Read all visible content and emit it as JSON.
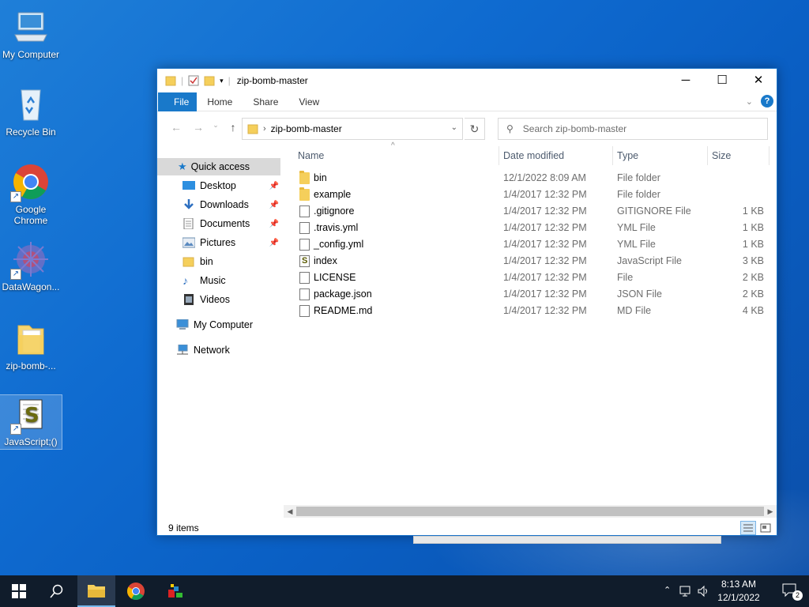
{
  "desktop": {
    "icons": [
      {
        "label": "My Computer"
      },
      {
        "label": "Recycle Bin"
      },
      {
        "label": "Google Chrome"
      },
      {
        "label": "DataWagon..."
      },
      {
        "label": "zip-bomb-..."
      },
      {
        "label": "JavaScript;()"
      }
    ]
  },
  "window": {
    "title": "zip-bomb-master",
    "controls": {
      "minimize": "─",
      "maximize": "☐",
      "close": "✕"
    },
    "ribbon_tabs": [
      "File",
      "Home",
      "Share",
      "View"
    ],
    "help": "?",
    "address": {
      "path": "zip-bomb-master"
    },
    "search": {
      "placeholder": "Search zip-bomb-master"
    }
  },
  "nav": {
    "quick_access": "Quick access",
    "items": [
      {
        "label": "Desktop",
        "pinned": true
      },
      {
        "label": "Downloads",
        "pinned": true
      },
      {
        "label": "Documents",
        "pinned": true
      },
      {
        "label": "Pictures",
        "pinned": true
      },
      {
        "label": "bin",
        "pinned": false
      },
      {
        "label": "Music",
        "pinned": false
      },
      {
        "label": "Videos",
        "pinned": false
      }
    ],
    "my_computer": "My Computer",
    "network": "Network"
  },
  "columns": {
    "name": "Name",
    "date": "Date modified",
    "type": "Type",
    "size": "Size"
  },
  "files": [
    {
      "name": "bin",
      "date": "12/1/2022 8:09 AM",
      "type": "File folder",
      "size": "",
      "icon": "folder-icon"
    },
    {
      "name": "example",
      "date": "1/4/2017 12:32 PM",
      "type": "File folder",
      "size": "",
      "icon": "folder-icon"
    },
    {
      "name": ".gitignore",
      "date": "1/4/2017 12:32 PM",
      "type": "GITIGNORE File",
      "size": "1 KB",
      "icon": "file-icon"
    },
    {
      "name": ".travis.yml",
      "date": "1/4/2017 12:32 PM",
      "type": "YML File",
      "size": "1 KB",
      "icon": "file-icon"
    },
    {
      "name": "_config.yml",
      "date": "1/4/2017 12:32 PM",
      "type": "YML File",
      "size": "1 KB",
      "icon": "file-icon"
    },
    {
      "name": "index",
      "date": "1/4/2017 12:32 PM",
      "type": "JavaScript File",
      "size": "3 KB",
      "icon": "script-icon"
    },
    {
      "name": "LICENSE",
      "date": "1/4/2017 12:32 PM",
      "type": "File",
      "size": "2 KB",
      "icon": "file-icon"
    },
    {
      "name": "package.json",
      "date": "1/4/2017 12:32 PM",
      "type": "JSON File",
      "size": "2 KB",
      "icon": "file-icon"
    },
    {
      "name": "README.md",
      "date": "1/4/2017 12:32 PM",
      "type": "MD File",
      "size": "4 KB",
      "icon": "file-icon"
    }
  ],
  "status": {
    "item_count": "9 items"
  },
  "taskbar": {
    "time": "8:13 AM",
    "date": "12/1/2022",
    "notifications": "2"
  },
  "colors": {
    "accent": "#1979ca",
    "taskbar": "#101c2b",
    "folder": "#f5cf5b"
  }
}
